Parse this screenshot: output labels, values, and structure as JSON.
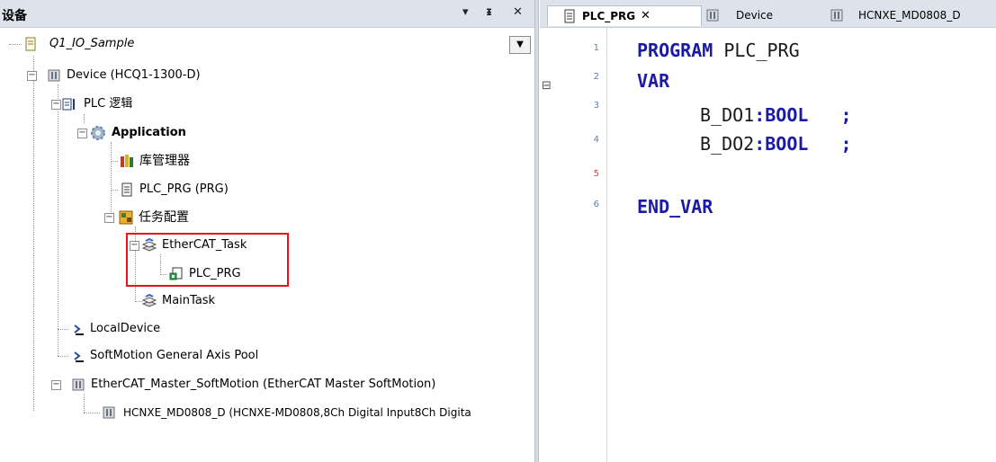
{
  "left_panel": {
    "title": "设备",
    "dropdown_btn": "▾",
    "pin_btn": "ᵖ",
    "close_btn": "✕",
    "project_name": "Q1_IO_Sample",
    "tree": {
      "device": "Device (HCQ1-1300-D)",
      "plc_logic": "PLC 逻辑",
      "application": "Application",
      "library_manager": "库管理器",
      "plc_prg_prg": "PLC_PRG (PRG)",
      "task_config": "任务配置",
      "ethercat_task": "EtherCAT_Task",
      "plc_prg": "PLC_PRG",
      "main_task": "MainTask",
      "local_device": "LocalDevice",
      "softmotion_pool": "SoftMotion General Axis Pool",
      "ethercat_master": "EtherCAT_Master_SoftMotion (EtherCAT Master SoftMotion)",
      "hcnxe": "HCNXE_MD0808_D (HCNXE-MD0808,8Ch Digital Input8Ch Digita"
    }
  },
  "tabs": [
    {
      "label": "PLC_PRG",
      "close": "✕"
    },
    {
      "label": "Device"
    },
    {
      "label": "HCNXE_MD0808_D"
    }
  ],
  "editor": {
    "line_numbers": [
      "1",
      "2",
      "3",
      "4",
      "5",
      "6"
    ],
    "fold_marker": "⊟",
    "lines": {
      "l1_kw": "PROGRAM",
      "l1_rest": " PLC_PRG",
      "l2_kw": "VAR",
      "l3_var": "B_DO1",
      "l3_colon": ":",
      "l3_type": "BOOL",
      "l3_semi": "   ;",
      "l4_var": "B_DO2",
      "l4_colon": ":",
      "l4_type": "BOOL",
      "l4_semi": "   ;",
      "l6_kw": "END_VAR"
    }
  },
  "colors": {
    "highlight": "#e8101a",
    "keyword": "#1a1aa8",
    "header_bg": "#dde3ea"
  }
}
